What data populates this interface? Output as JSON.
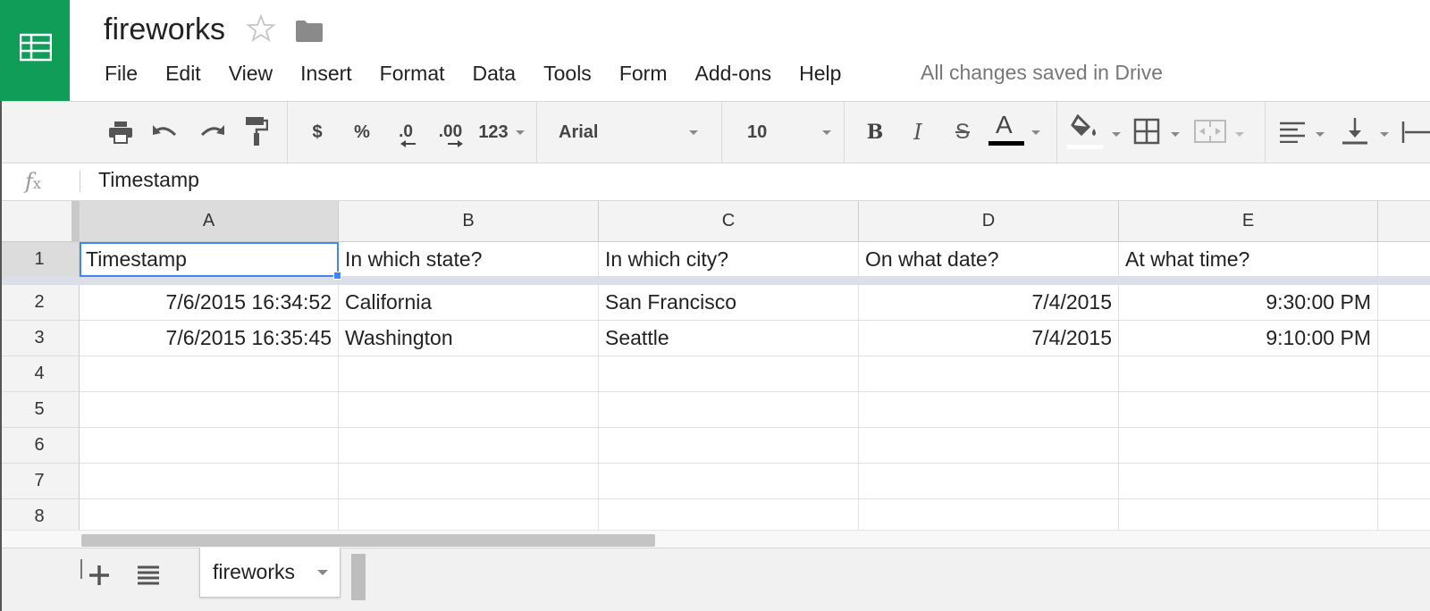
{
  "app": {
    "doc_title": "fireworks",
    "save_status": "All changes saved in Drive",
    "brand_color": "#0f9d58"
  },
  "menu": [
    "File",
    "Edit",
    "View",
    "Insert",
    "Format",
    "Data",
    "Tools",
    "Form",
    "Add-ons",
    "Help"
  ],
  "toolbar": {
    "currency_label": "$",
    "percent_label": "%",
    "decrease_decimal_label": ".0",
    "increase_decimal_label": ".00",
    "more_formats_label": "123",
    "font_name": "Arial",
    "font_size": "10",
    "bold_label": "B",
    "italic_label": "I",
    "strike_label": "S",
    "text_color_label": "A",
    "icons": [
      "print-icon",
      "undo-icon",
      "redo-icon",
      "paint-format-icon",
      "fill-color-icon",
      "borders-icon",
      "merge-cells-icon",
      "align-left-icon",
      "vertical-align-icon",
      "text-wrap-icon"
    ]
  },
  "formula_bar": {
    "fx_label": "f",
    "fx_sub": "x",
    "value": "Timestamp"
  },
  "grid": {
    "columns": [
      "A",
      "B",
      "C",
      "D",
      "E"
    ],
    "rows": [
      "1",
      "2",
      "3",
      "4",
      "5",
      "6",
      "7",
      "8"
    ],
    "selected_cell": "A1",
    "cells": [
      [
        "Timestamp",
        "In which state?",
        "In which city?",
        "On what date?",
        "At what time?"
      ],
      [
        "7/6/2015 16:34:52",
        "California",
        "San Francisco",
        "7/4/2015",
        "9:30:00 PM"
      ],
      [
        "7/6/2015 16:35:45",
        "Washington",
        "Seattle",
        "7/4/2015",
        "9:10:00 PM"
      ],
      [
        "",
        "",
        "",
        "",
        ""
      ],
      [
        "",
        "",
        "",
        "",
        ""
      ],
      [
        "",
        "",
        "",
        "",
        ""
      ],
      [
        "",
        "",
        "",
        "",
        ""
      ],
      [
        "",
        "",
        "",
        "",
        ""
      ]
    ]
  },
  "sheets": {
    "tabs": [
      "fireworks"
    ],
    "active": "fireworks"
  }
}
